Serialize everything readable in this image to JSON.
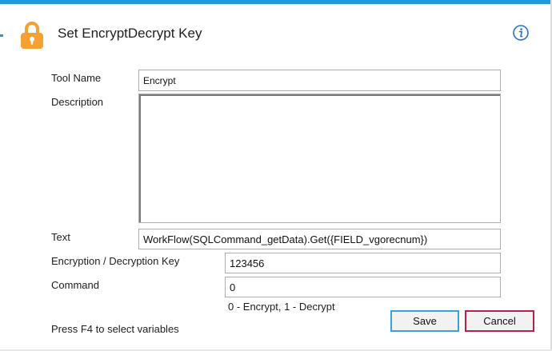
{
  "dialog": {
    "title": "Set EncryptDecrypt Key"
  },
  "icons": {
    "title_icon": "lock-icon",
    "help_icon": "info-icon",
    "accent_color": "#f5a030",
    "info_color": "#2b6fd0"
  },
  "form": {
    "tool_name": {
      "label": "Tool Name",
      "value": "Encrypt"
    },
    "description": {
      "label": "Description",
      "value": ""
    },
    "text": {
      "label": "Text",
      "value": "WorkFlow(SQLCommand_getData).Get({FIELD_vgorecnum})"
    },
    "key": {
      "label": "Encryption / Decryption Key",
      "value": "123456"
    },
    "command": {
      "label": "Command",
      "value": "0",
      "hint": "0 - Encrypt, 1 - Decrypt"
    }
  },
  "footer": {
    "hint": "Press F4 to select variables",
    "save_label": "Save",
    "cancel_label": "Cancel"
  }
}
